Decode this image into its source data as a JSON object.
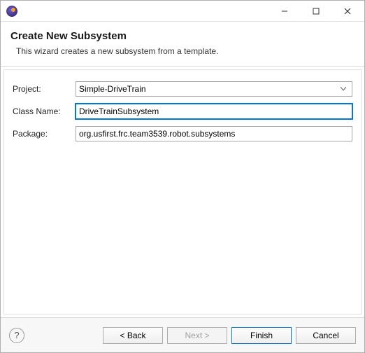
{
  "header": {
    "title": "Create New Subsystem",
    "description": "This wizard creates a new subsystem from a template."
  },
  "form": {
    "project": {
      "label": "Project:",
      "value": "Simple-DriveTrain"
    },
    "className": {
      "label": "Class Name:",
      "value": "DriveTrainSubsystem"
    },
    "package": {
      "label": "Package:",
      "value": "org.usfirst.frc.team3539.robot.subsystems"
    }
  },
  "footer": {
    "help": "?",
    "back": "< Back",
    "next": "Next >",
    "finish": "Finish",
    "cancel": "Cancel"
  }
}
